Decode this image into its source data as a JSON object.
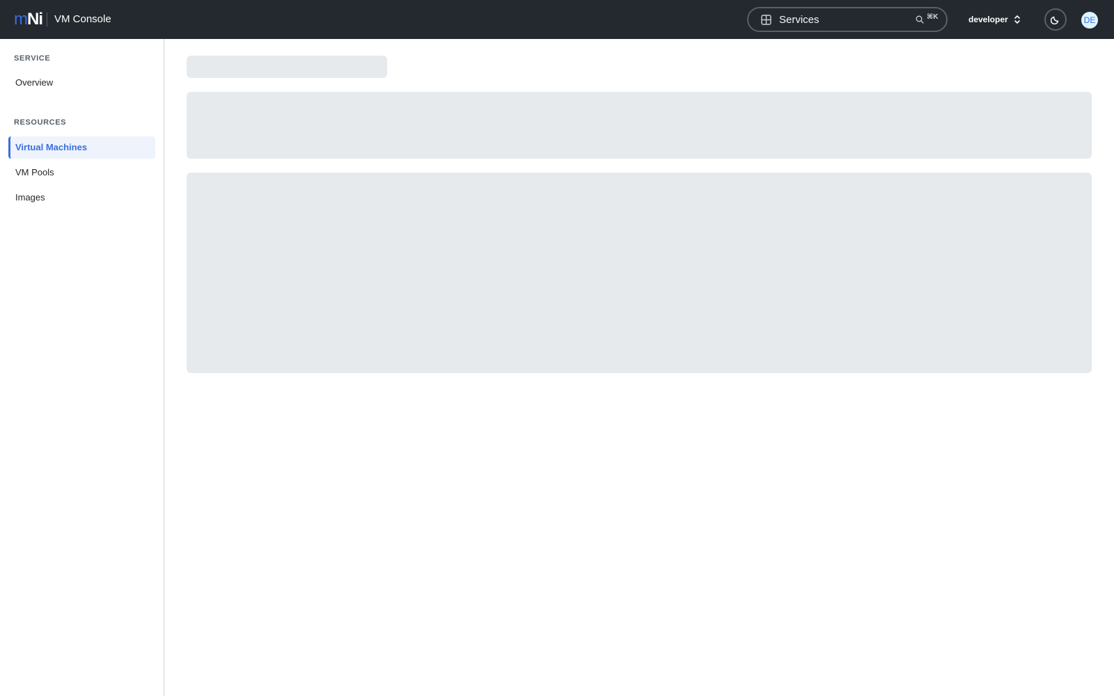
{
  "topbar": {
    "logo": {
      "part1": "m",
      "part2": "N",
      "part3": "i"
    },
    "app_title": "VM Console",
    "service_switcher": {
      "label": "Services",
      "shortcut": "⌘K"
    },
    "org_switcher": {
      "label": "developer"
    },
    "avatar_initials": "DE"
  },
  "sidebar": {
    "sections": [
      {
        "heading": "SERVICE",
        "items": [
          {
            "label": "Overview"
          }
        ]
      },
      {
        "heading": "RESOURCES",
        "items": [
          {
            "label": "Virtual Machines",
            "active": true
          },
          {
            "label": "VM Pools"
          },
          {
            "label": "Images"
          }
        ]
      }
    ]
  },
  "colors": {
    "topbar_bg": "#24292f",
    "accent": "#3b6ee0",
    "skeleton": "#e6eaed"
  }
}
